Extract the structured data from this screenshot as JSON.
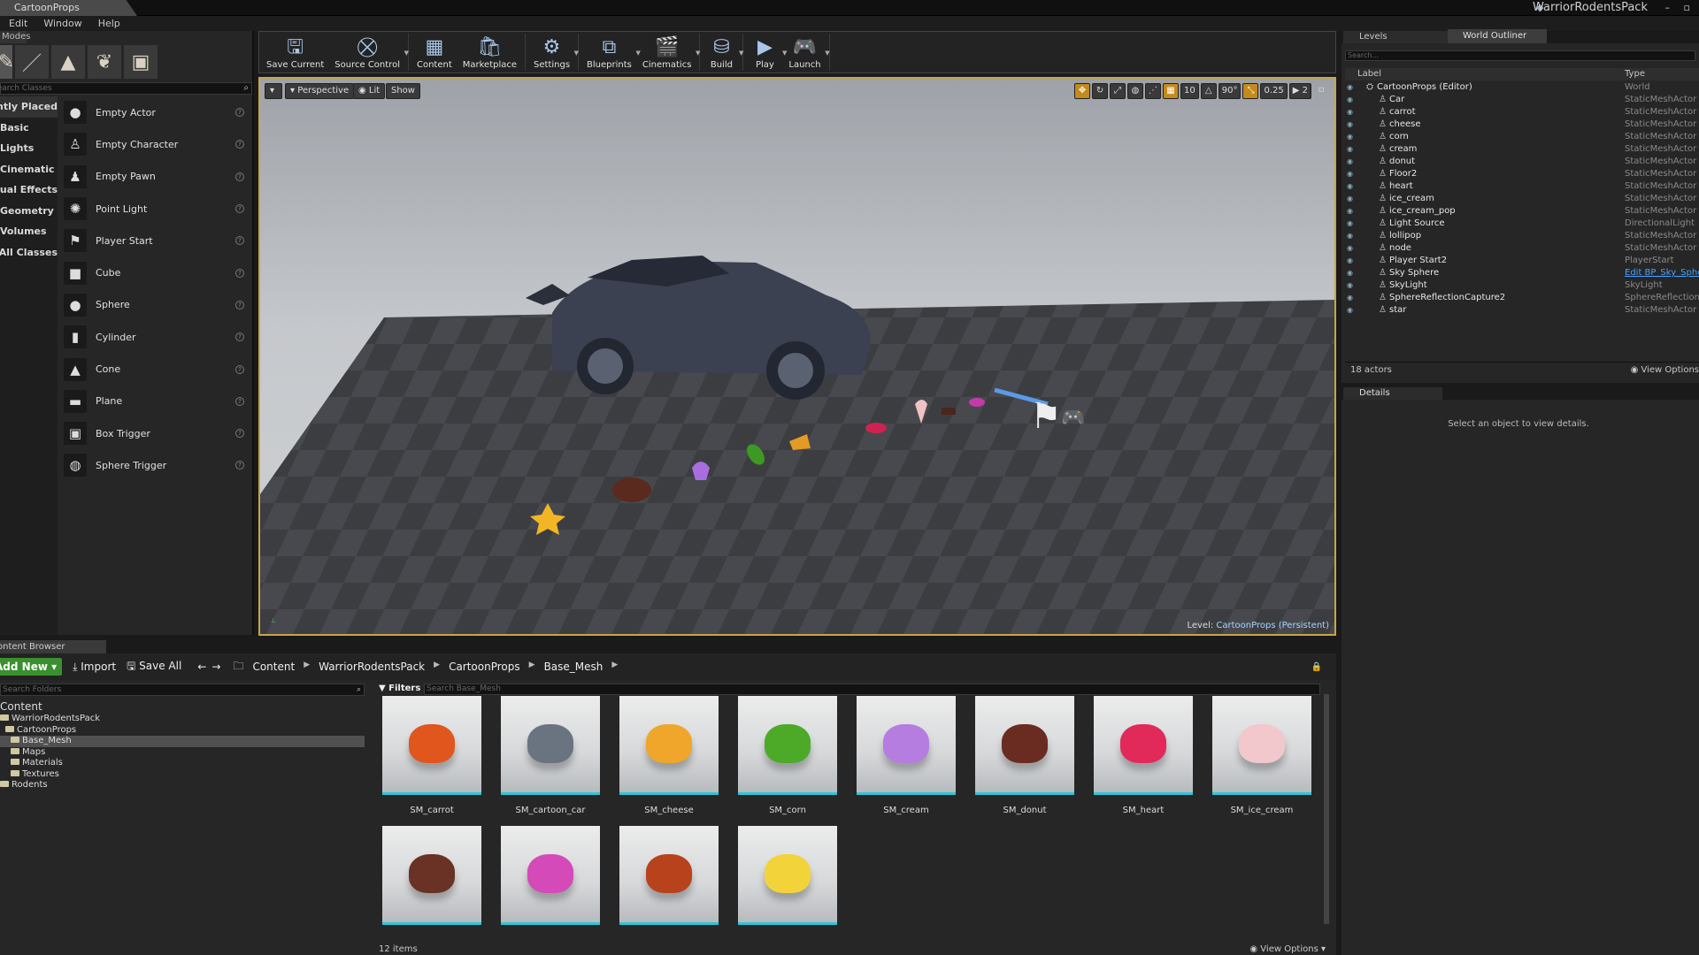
{
  "window": {
    "tab": "CartoonProps",
    "app_name": "WarriorRodentsPack"
  },
  "menu": [
    "Edit",
    "Window",
    "Help"
  ],
  "modes": {
    "tab": "Modes",
    "search_placeholder": "Search Classes",
    "categories": [
      "Recently Placed",
      "Basic",
      "Lights",
      "Cinematic",
      "Visual Effects",
      "Geometry",
      "Volumes",
      "All Classes"
    ],
    "items": [
      "Empty Actor",
      "Empty Character",
      "Empty Pawn",
      "Point Light",
      "Player Start",
      "Cube",
      "Sphere",
      "Cylinder",
      "Cone",
      "Plane",
      "Box Trigger",
      "Sphere Trigger"
    ]
  },
  "toolbar": [
    {
      "label": "Save Current",
      "icon": "save-icon",
      "drop": false
    },
    {
      "label": "Source Control",
      "icon": "source-control-icon",
      "drop": true
    },
    {
      "label": "Content",
      "icon": "content-icon",
      "drop": false
    },
    {
      "label": "Marketplace",
      "icon": "marketplace-icon",
      "drop": false
    },
    {
      "label": "Settings",
      "icon": "settings-icon",
      "drop": true
    },
    {
      "label": "Blueprints",
      "icon": "blueprints-icon",
      "drop": true
    },
    {
      "label": "Cinematics",
      "icon": "cinematics-icon",
      "drop": true
    },
    {
      "label": "Build",
      "icon": "build-icon",
      "drop": true
    },
    {
      "label": "Play",
      "icon": "play-icon",
      "drop": true
    },
    {
      "label": "Launch",
      "icon": "launch-icon",
      "drop": true
    }
  ],
  "viewport": {
    "perspective": "Perspective",
    "lit": "Lit",
    "show": "Show",
    "grid_snap": "10",
    "rot_snap": "90°",
    "scale_snap": "0.25",
    "cam_speed": "2",
    "level_label": "Level:",
    "level_name": "CartoonProps (Persistent)"
  },
  "levels_tab": "Levels",
  "outliner": {
    "tab": "World Outliner",
    "search_placeholder": "Search...",
    "col_label": "Label",
    "col_type": "Type",
    "rows": [
      {
        "label": "CartoonProps (Editor)",
        "type": "World",
        "indent": 0
      },
      {
        "label": "Car",
        "type": "StaticMeshActor",
        "indent": 1
      },
      {
        "label": "carrot",
        "type": "StaticMeshActor",
        "indent": 1
      },
      {
        "label": "cheese",
        "type": "StaticMeshActor",
        "indent": 1
      },
      {
        "label": "corn",
        "type": "StaticMeshActor",
        "indent": 1
      },
      {
        "label": "cream",
        "type": "StaticMeshActor",
        "indent": 1
      },
      {
        "label": "donut",
        "type": "StaticMeshActor",
        "indent": 1
      },
      {
        "label": "Floor2",
        "type": "StaticMeshActor",
        "indent": 1
      },
      {
        "label": "heart",
        "type": "StaticMeshActor",
        "indent": 1
      },
      {
        "label": "ice_cream",
        "type": "StaticMeshActor",
        "indent": 1
      },
      {
        "label": "ice_cream_pop",
        "type": "StaticMeshActor",
        "indent": 1
      },
      {
        "label": "Light Source",
        "type": "DirectionalLight",
        "indent": 1
      },
      {
        "label": "lollipop",
        "type": "StaticMeshActor",
        "indent": 1
      },
      {
        "label": "node",
        "type": "StaticMeshActor",
        "indent": 1
      },
      {
        "label": "Player Start2",
        "type": "PlayerStart",
        "indent": 1
      },
      {
        "label": "Sky Sphere",
        "type": "Edit BP_Sky_Sphere",
        "indent": 1,
        "link": true
      },
      {
        "label": "SkyLight",
        "type": "SkyLight",
        "indent": 1
      },
      {
        "label": "SphereReflectionCapture2",
        "type": "SphereReflectionCapture",
        "indent": 1
      },
      {
        "label": "star",
        "type": "StaticMeshActor",
        "indent": 1
      }
    ],
    "count": "18 actors",
    "view_options": "View Options"
  },
  "details": {
    "tab": "Details",
    "message": "Select an object to view details."
  },
  "content_browser": {
    "tab": "Content Browser",
    "add_new": "Add New",
    "import": "Import",
    "save_all": "Save All",
    "breadcrumbs": [
      "Content",
      "WarriorRodentsPack",
      "CartoonProps",
      "Base_Mesh"
    ],
    "folder_search": "Search Folders",
    "tree": [
      {
        "label": "Content",
        "level": 0
      },
      {
        "label": "WarriorRodentsPack",
        "level": 0
      },
      {
        "label": "CartoonProps",
        "level": 1
      },
      {
        "label": "Base_Mesh",
        "level": 2,
        "selected": true
      },
      {
        "label": "Maps",
        "level": 2
      },
      {
        "label": "Materials",
        "level": 2
      },
      {
        "label": "Textures",
        "level": 2
      },
      {
        "label": "Rodents",
        "level": 0
      }
    ],
    "filters": "Filters",
    "asset_search": "Search Base_Mesh",
    "assets": [
      {
        "name": "SM_carrot",
        "color": "#e0561c"
      },
      {
        "name": "SM_cartoon_car",
        "color": "#6a7480"
      },
      {
        "name": "SM_cheese",
        "color": "#f0a62a"
      },
      {
        "name": "SM_corn",
        "color": "#4caa28"
      },
      {
        "name": "SM_cream",
        "color": "#b67de0"
      },
      {
        "name": "SM_donut",
        "color": "#6a2c20"
      },
      {
        "name": "SM_heart",
        "color": "#e22a5a"
      },
      {
        "name": "SM_ice_cream",
        "color": "#f2c8cc"
      },
      {
        "name": "",
        "color": "#6a3224"
      },
      {
        "name": "",
        "color": "#d44ab8"
      },
      {
        "name": "",
        "color": "#b8421c"
      },
      {
        "name": "",
        "color": "#f2d43a"
      }
    ],
    "items_count": "12 items",
    "view_options": "View Options"
  }
}
